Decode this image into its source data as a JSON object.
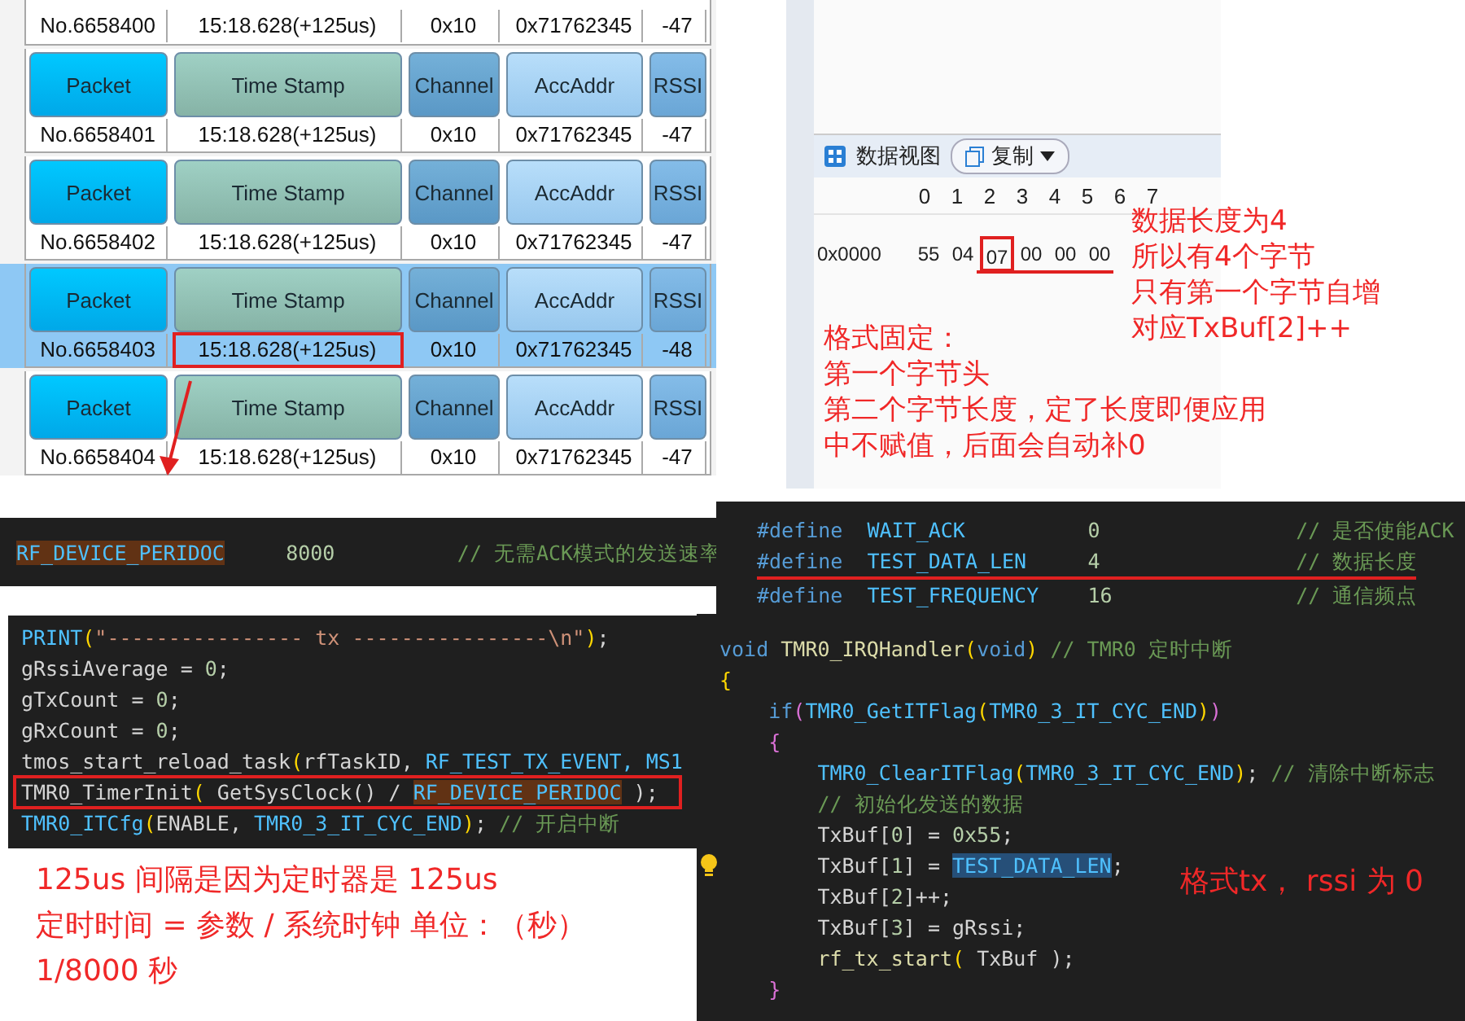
{
  "packet_table": {
    "rows": [
      {
        "headers": [],
        "values": [
          "No.6658400",
          "15:18.628(+125us)",
          "0x10",
          "0x71762345",
          "-47"
        ],
        "selected": false,
        "marked": false
      },
      {
        "headers": [
          "Packet",
          "Time Stamp",
          "Channel",
          "AccAddr",
          "RSSI"
        ],
        "values": [
          "No.6658401",
          "15:18.628(+125us)",
          "0x10",
          "0x71762345",
          "-47"
        ],
        "selected": false,
        "marked": false
      },
      {
        "headers": [
          "Packet",
          "Time Stamp",
          "Channel",
          "AccAddr",
          "RSSI"
        ],
        "values": [
          "No.6658402",
          "15:18.628(+125us)",
          "0x10",
          "0x71762345",
          "-47"
        ],
        "selected": false,
        "marked": false
      },
      {
        "headers": [
          "Packet",
          "Time Stamp",
          "Channel",
          "AccAddr",
          "RSSI"
        ],
        "values": [
          "No.6658403",
          "15:18.628(+125us)",
          "0x10",
          "0x71762345",
          "-48"
        ],
        "selected": true,
        "marked": true
      },
      {
        "headers": [
          "Packet",
          "Time Stamp",
          "Channel",
          "AccAddr",
          "RSSI"
        ],
        "values": [
          "No.6658404",
          "15:18.628(+125us)",
          "0x10",
          "0x71762345",
          "-47"
        ],
        "selected": false,
        "marked": false
      }
    ]
  },
  "data_view": {
    "title": "数据视图",
    "copy_button": "复制",
    "columns": [
      "0",
      "1",
      "2",
      "3",
      "4",
      "5",
      "6",
      "7"
    ],
    "rows": [
      {
        "address": "0x0000",
        "bytes": [
          {
            "value": "55",
            "marked": false
          },
          {
            "value": "04",
            "marked": false
          },
          {
            "value": "07",
            "marked": true
          },
          {
            "value": "00",
            "marked": false
          },
          {
            "value": "00",
            "marked": false
          },
          {
            "value": "00",
            "marked": false
          }
        ]
      }
    ],
    "length_notes": [
      "数据长度为4",
      "所以有4个字节",
      "只有第一个字节自增",
      "对应TxBuf[2]++"
    ],
    "format_notes": [
      "格式固定：",
      "第一个字节头",
      "第二个字节长度，定了长度即便应用",
      "中不赋值，后面会自动补0"
    ]
  },
  "config_line": {
    "tokens": [
      {
        "text": "RF_DEVICE_PERIDOC",
        "kind": "macro",
        "highlighted": true
      },
      {
        "text": "     8000",
        "kind": "number"
      },
      {
        "text": "          // 无需ACK模式的发送速率",
        "kind": "comment"
      }
    ]
  },
  "defines": [
    {
      "underlined": false,
      "tokens": [
        {
          "text": "#define",
          "kind": "keyword"
        },
        {
          "text": "  WAIT_ACK          ",
          "kind": "macro"
        },
        {
          "text": "0",
          "kind": "number"
        },
        {
          "text": "                // 是否使能ACK",
          "kind": "comment"
        }
      ]
    },
    {
      "underlined": true,
      "tokens": [
        {
          "text": "#define",
          "kind": "keyword"
        },
        {
          "text": "  TEST_DATA_LEN     ",
          "kind": "macro"
        },
        {
          "text": "4",
          "kind": "number"
        },
        {
          "text": "                // 数据长度",
          "kind": "comment"
        }
      ]
    },
    {
      "underlined": false,
      "tokens": [
        {
          "text": "#define",
          "kind": "keyword"
        },
        {
          "text": "  TEST_FREQUENCY    ",
          "kind": "macro"
        },
        {
          "text": "16",
          "kind": "number"
        },
        {
          "text": "               // 通信频点",
          "kind": "comment"
        }
      ]
    }
  ],
  "init_code": [
    {
      "boxed": false,
      "tokens": [
        {
          "text": "PRINT",
          "kind": "macro"
        },
        {
          "text": "(",
          "kind": "bracket"
        },
        {
          "text": "\"---------------- tx ----------------\\n\"",
          "kind": "string"
        },
        {
          "text": ")",
          "kind": "bracket"
        },
        {
          "text": ";",
          "kind": "plain"
        }
      ]
    },
    {
      "boxed": false,
      "tokens": [
        {
          "text": "gRssiAverage = ",
          "kind": "plain"
        },
        {
          "text": "0",
          "kind": "number"
        },
        {
          "text": ";",
          "kind": "plain"
        }
      ]
    },
    {
      "boxed": false,
      "tokens": [
        {
          "text": "gTxCount = ",
          "kind": "plain"
        },
        {
          "text": "0",
          "kind": "number"
        },
        {
          "text": ";",
          "kind": "plain"
        }
      ]
    },
    {
      "boxed": false,
      "tokens": [
        {
          "text": "gRxCount = ",
          "kind": "plain"
        },
        {
          "text": "0",
          "kind": "number"
        },
        {
          "text": ";",
          "kind": "plain"
        }
      ]
    },
    {
      "boxed": false,
      "tokens": [
        {
          "text": "tmos_start_reload_task",
          "kind": "plain"
        },
        {
          "text": "(",
          "kind": "bracket"
        },
        {
          "text": "rfTaskID, ",
          "kind": "plain"
        },
        {
          "text": "RF_TEST_TX_EVENT, MS1",
          "kind": "macro"
        }
      ]
    },
    {
      "boxed": true,
      "tokens": [
        {
          "text": "TMR0_TimerInit",
          "kind": "plain"
        },
        {
          "text": "( ",
          "kind": "bracket"
        },
        {
          "text": "GetSysClock() / ",
          "kind": "plain"
        },
        {
          "text": "RF_DEVICE_PERIDOC",
          "kind": "macro",
          "highlighted": true
        },
        {
          "text": " );",
          "kind": "plain"
        }
      ]
    },
    {
      "boxed": false,
      "tokens": [
        {
          "text": "TMR0_ITCfg",
          "kind": "macro"
        },
        {
          "text": "(",
          "kind": "bracket"
        },
        {
          "text": "ENABLE, ",
          "kind": "plain"
        },
        {
          "text": "TMR0_3_IT_CYC_END",
          "kind": "macro"
        },
        {
          "text": ")",
          "kind": "bracket"
        },
        {
          "text": "; ",
          "kind": "plain"
        },
        {
          "text": "// 开启中断",
          "kind": "comment"
        }
      ]
    }
  ],
  "timer_notes": [
    "125us 间隔是因为定时器是 125us",
    "定时时间 = 参数 / 系统时钟   单位：（秒）",
    "1/8000 秒"
  ],
  "handler_code": [
    {
      "lightbulb": false,
      "tokens": [
        {
          "text": "void ",
          "kind": "keyword"
        },
        {
          "text": "TMR0_IRQHandler",
          "kind": "function"
        },
        {
          "text": "(",
          "kind": "bracket"
        },
        {
          "text": "void",
          "kind": "keyword"
        },
        {
          "text": ")",
          "kind": "bracket"
        },
        {
          "text": " // TMR0 定时中断",
          "kind": "comment"
        }
      ]
    },
    {
      "lightbulb": false,
      "tokens": [
        {
          "text": "{",
          "kind": "bracket"
        }
      ]
    },
    {
      "lightbulb": false,
      "tokens": [
        {
          "text": "    if",
          "kind": "keyword"
        },
        {
          "text": "(",
          "kind": "bracket2"
        },
        {
          "text": "TMR0_GetITFlag",
          "kind": "macro"
        },
        {
          "text": "(",
          "kind": "bracket"
        },
        {
          "text": "TMR0_3_IT_CYC_END",
          "kind": "macro"
        },
        {
          "text": ")",
          "kind": "bracket"
        },
        {
          "text": ")",
          "kind": "bracket2"
        }
      ]
    },
    {
      "lightbulb": false,
      "tokens": [
        {
          "text": "    {",
          "kind": "bracket2"
        }
      ]
    },
    {
      "lightbulb": false,
      "tokens": [
        {
          "text": "        TMR0_ClearITFlag",
          "kind": "macro"
        },
        {
          "text": "(",
          "kind": "bracket"
        },
        {
          "text": "TMR0_3_IT_CYC_END",
          "kind": "macro"
        },
        {
          "text": ")",
          "kind": "bracket"
        },
        {
          "text": "; ",
          "kind": "plain"
        },
        {
          "text": "// 清除中断标志",
          "kind": "comment"
        }
      ]
    },
    {
      "lightbulb": false,
      "tokens": [
        {
          "text": "        // 初始化发送的数据",
          "kind": "comment"
        }
      ]
    },
    {
      "lightbulb": false,
      "tokens": [
        {
          "text": "        TxBuf[",
          "kind": "plain"
        },
        {
          "text": "0",
          "kind": "number"
        },
        {
          "text": "] = ",
          "kind": "plain"
        },
        {
          "text": "0x55",
          "kind": "number"
        },
        {
          "text": ";",
          "kind": "plain"
        }
      ]
    },
    {
      "lightbulb": true,
      "tokens": [
        {
          "text": "        TxBuf[",
          "kind": "plain"
        },
        {
          "text": "1",
          "kind": "number"
        },
        {
          "text": "] = ",
          "kind": "plain"
        },
        {
          "text": "TEST_DATA_LEN",
          "kind": "macro",
          "selected": true
        },
        {
          "text": ";",
          "kind": "plain"
        }
      ]
    },
    {
      "lightbulb": false,
      "tokens": [
        {
          "text": "        TxBuf[",
          "kind": "plain"
        },
        {
          "text": "2",
          "kind": "number"
        },
        {
          "text": "]++;",
          "kind": "plain"
        }
      ]
    },
    {
      "lightbulb": false,
      "tokens": [
        {
          "text": "        TxBuf[",
          "kind": "plain"
        },
        {
          "text": "3",
          "kind": "number"
        },
        {
          "text": "] = gRssi;",
          "kind": "plain"
        }
      ]
    },
    {
      "lightbulb": false,
      "tokens": [
        {
          "text": "        rf_tx_start",
          "kind": "function"
        },
        {
          "text": "( ",
          "kind": "bracket"
        },
        {
          "text": "TxBuf ",
          "kind": "plain"
        },
        {
          "text": ");",
          "kind": "plain"
        }
      ]
    },
    {
      "lightbulb": false,
      "tokens": [
        {
          "text": "    }",
          "kind": "bracket2"
        }
      ]
    }
  ],
  "handler_note": "格式tx， rssi 为 0"
}
